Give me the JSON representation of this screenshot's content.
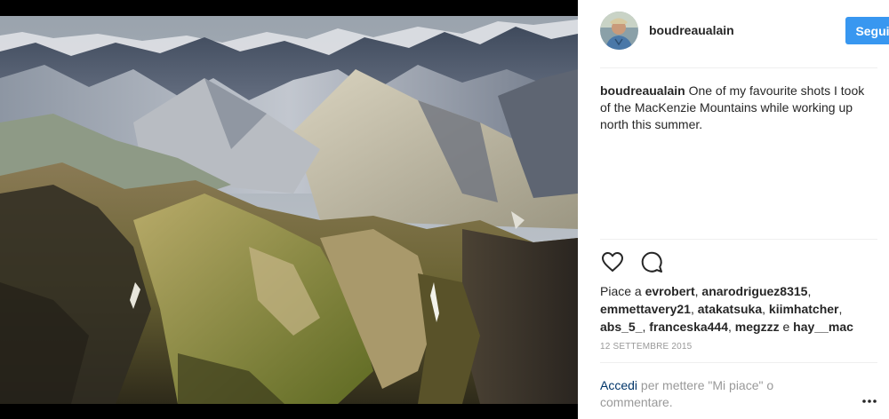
{
  "post": {
    "username": "boudreaualain",
    "follow_label": "Segui",
    "caption": "One of my favourite shots I took of the MacKenzie Mountains while working up north this summer.",
    "likes_prefix": "Piace a",
    "likers": [
      "evrobert",
      "anarodriguez8315",
      "emmettavery21",
      "atakatsuka",
      "kiimhatcher",
      "abs_5_",
      "franceska444",
      "megzzz"
    ],
    "likers_last_sep": "e",
    "last_liker": "hay__mac",
    "date": "12 SETTEMBRE 2015",
    "login_link": "Accedi",
    "login_text": "per mettere \"Mi piace\" o commentare.",
    "colors": {
      "follow_button": "#3897f0",
      "link": "#003569",
      "muted": "#999999"
    },
    "icons": [
      "heart-icon",
      "comment-icon",
      "more-options-icon"
    ]
  }
}
